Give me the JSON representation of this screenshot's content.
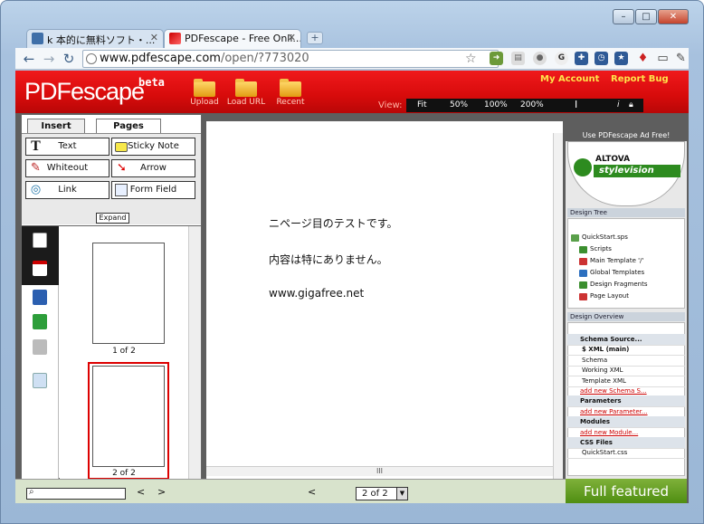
{
  "browser": {
    "tabs": [
      {
        "title": "k 本的に無料ソフト・...",
        "active": false
      },
      {
        "title": "PDFescape - Free Onli...",
        "active": true
      }
    ],
    "url_host": "www.pdfescape.com",
    "url_path": "/open/?773020",
    "window_controls": [
      "minimize",
      "maximize",
      "close"
    ],
    "extension_icons": [
      "page-icon",
      "green-arrow-icon",
      "blank-page-icon",
      "circle-icon",
      "google-icon",
      "puzzle-icon",
      "clock-icon",
      "star-icon",
      "map-pin-icon",
      "wrench-icon"
    ]
  },
  "app": {
    "logo": "PDFescape",
    "beta": "beta",
    "header_buttons": [
      "Upload",
      "Load URL",
      "Recent"
    ],
    "my_account": "My Account",
    "report_bug": "Report Bug",
    "view_label": "View:",
    "view_options": [
      "Fit",
      "50%",
      "100%",
      "200%"
    ],
    "info_glyph": "i",
    "colors": {
      "header": "#d70b0b",
      "link": "#ffe34a",
      "full_featured": "#5d9b1e"
    }
  },
  "left": {
    "tabs": [
      "Insert",
      "Pages"
    ],
    "tools": [
      {
        "label": "Text",
        "icon": "text-icon"
      },
      {
        "label": "Sticky Note",
        "icon": "sticky-note-icon"
      },
      {
        "label": "Whiteout",
        "icon": "whiteout-icon"
      },
      {
        "label": "Arrow",
        "icon": "arrow-icon"
      },
      {
        "label": "Link",
        "icon": "link-icon"
      },
      {
        "label": "Form Field",
        "icon": "form-field-icon"
      }
    ],
    "expand": "Expand",
    "thumbnails": [
      {
        "label": "1 of 2",
        "selected": false
      },
      {
        "label": "2 of 2",
        "selected": true
      }
    ]
  },
  "document": {
    "lines": [
      "ニページ目のテストです。",
      "内容は特にありません。",
      "www.gigafree.net"
    ],
    "hscroll_glyph": "III"
  },
  "ad": {
    "header": "Use PDFescape Ad Free!",
    "altova": "ALTOVA",
    "stylevision": "stylevision",
    "design_tree_title": "Design Tree",
    "tree_items": [
      "QuickStart.sps",
      "Scripts",
      "Main Template '/'",
      "Global Templates",
      "Design Fragments",
      "Page Layout"
    ],
    "design_overview_title": "Design Overview",
    "overview_rows": [
      {
        "text": "Schema Source...",
        "style": "head"
      },
      {
        "text": "$ XML (main)",
        "style": "bold"
      },
      {
        "text": "Schema",
        "style": "item"
      },
      {
        "text": "Working XML",
        "style": "item"
      },
      {
        "text": "Template XML",
        "style": "item"
      },
      {
        "text": "add new Schema S...",
        "style": "link"
      },
      {
        "text": "Parameters",
        "style": "head"
      },
      {
        "text": "add new Parameter...",
        "style": "link"
      },
      {
        "text": "Modules",
        "style": "head"
      },
      {
        "text": "add new Module...",
        "style": "link"
      },
      {
        "text": "CSS Files",
        "style": "head"
      },
      {
        "text": "QuickStart.css",
        "style": "item"
      }
    ],
    "full_featured": "Full featured"
  },
  "bottom": {
    "prev": "<",
    "next": ">",
    "page_prev": "<",
    "page_select": "2 of 2"
  }
}
